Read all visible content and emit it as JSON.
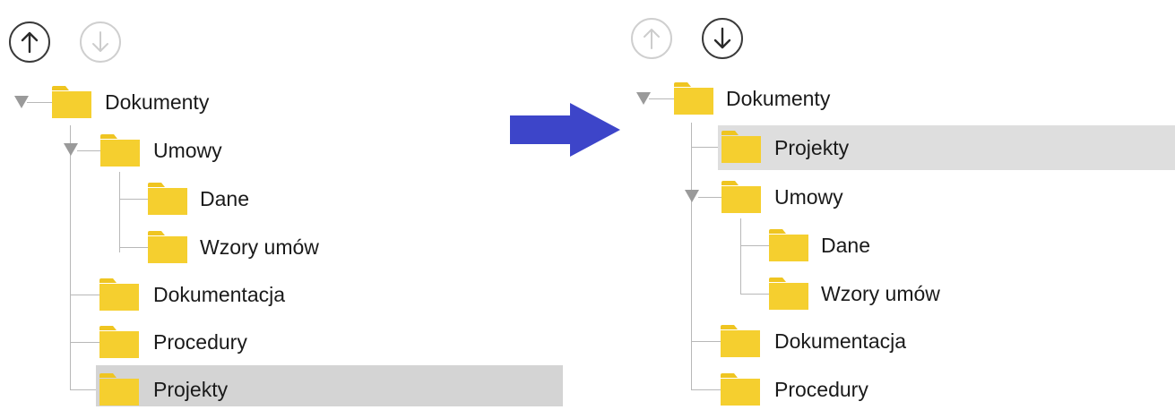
{
  "colors": {
    "folder": "#f5cf2f",
    "folder_tab": "#efc521",
    "arrow": "#3d45c9",
    "selected_row": "#dedede",
    "tree_line": "#b8b8b8",
    "expander": "#9a9a9a",
    "button_active": "#3a3a3a",
    "button_disabled": "#cfcfcf"
  },
  "before": {
    "buttons": {
      "move_up": {
        "icon": "arrow-up-icon",
        "enabled": true
      },
      "move_down": {
        "icon": "arrow-down-icon",
        "enabled": false
      }
    },
    "tree": {
      "root": {
        "label": "Dokumenty",
        "expanded": true
      },
      "umowy": {
        "label": "Umowy",
        "expanded": true
      },
      "dane": {
        "label": "Dane"
      },
      "wzory": {
        "label": "Wzory umów"
      },
      "dokumentacja": {
        "label": "Dokumentacja"
      },
      "procedury": {
        "label": "Procedury"
      },
      "projekty": {
        "label": "Projekty",
        "selected": true
      }
    }
  },
  "transition": {
    "icon": "right-arrow-icon"
  },
  "after": {
    "buttons": {
      "move_up": {
        "icon": "arrow-up-icon",
        "enabled": false
      },
      "move_down": {
        "icon": "arrow-down-icon",
        "enabled": true
      }
    },
    "tree": {
      "root": {
        "label": "Dokumenty",
        "expanded": true
      },
      "projekty": {
        "label": "Projekty",
        "selected": true
      },
      "umowy": {
        "label": "Umowy",
        "expanded": true
      },
      "dane": {
        "label": "Dane"
      },
      "wzory": {
        "label": "Wzory umów"
      },
      "dokumentacja": {
        "label": "Dokumentacja"
      },
      "procedury": {
        "label": "Procedury"
      }
    }
  }
}
